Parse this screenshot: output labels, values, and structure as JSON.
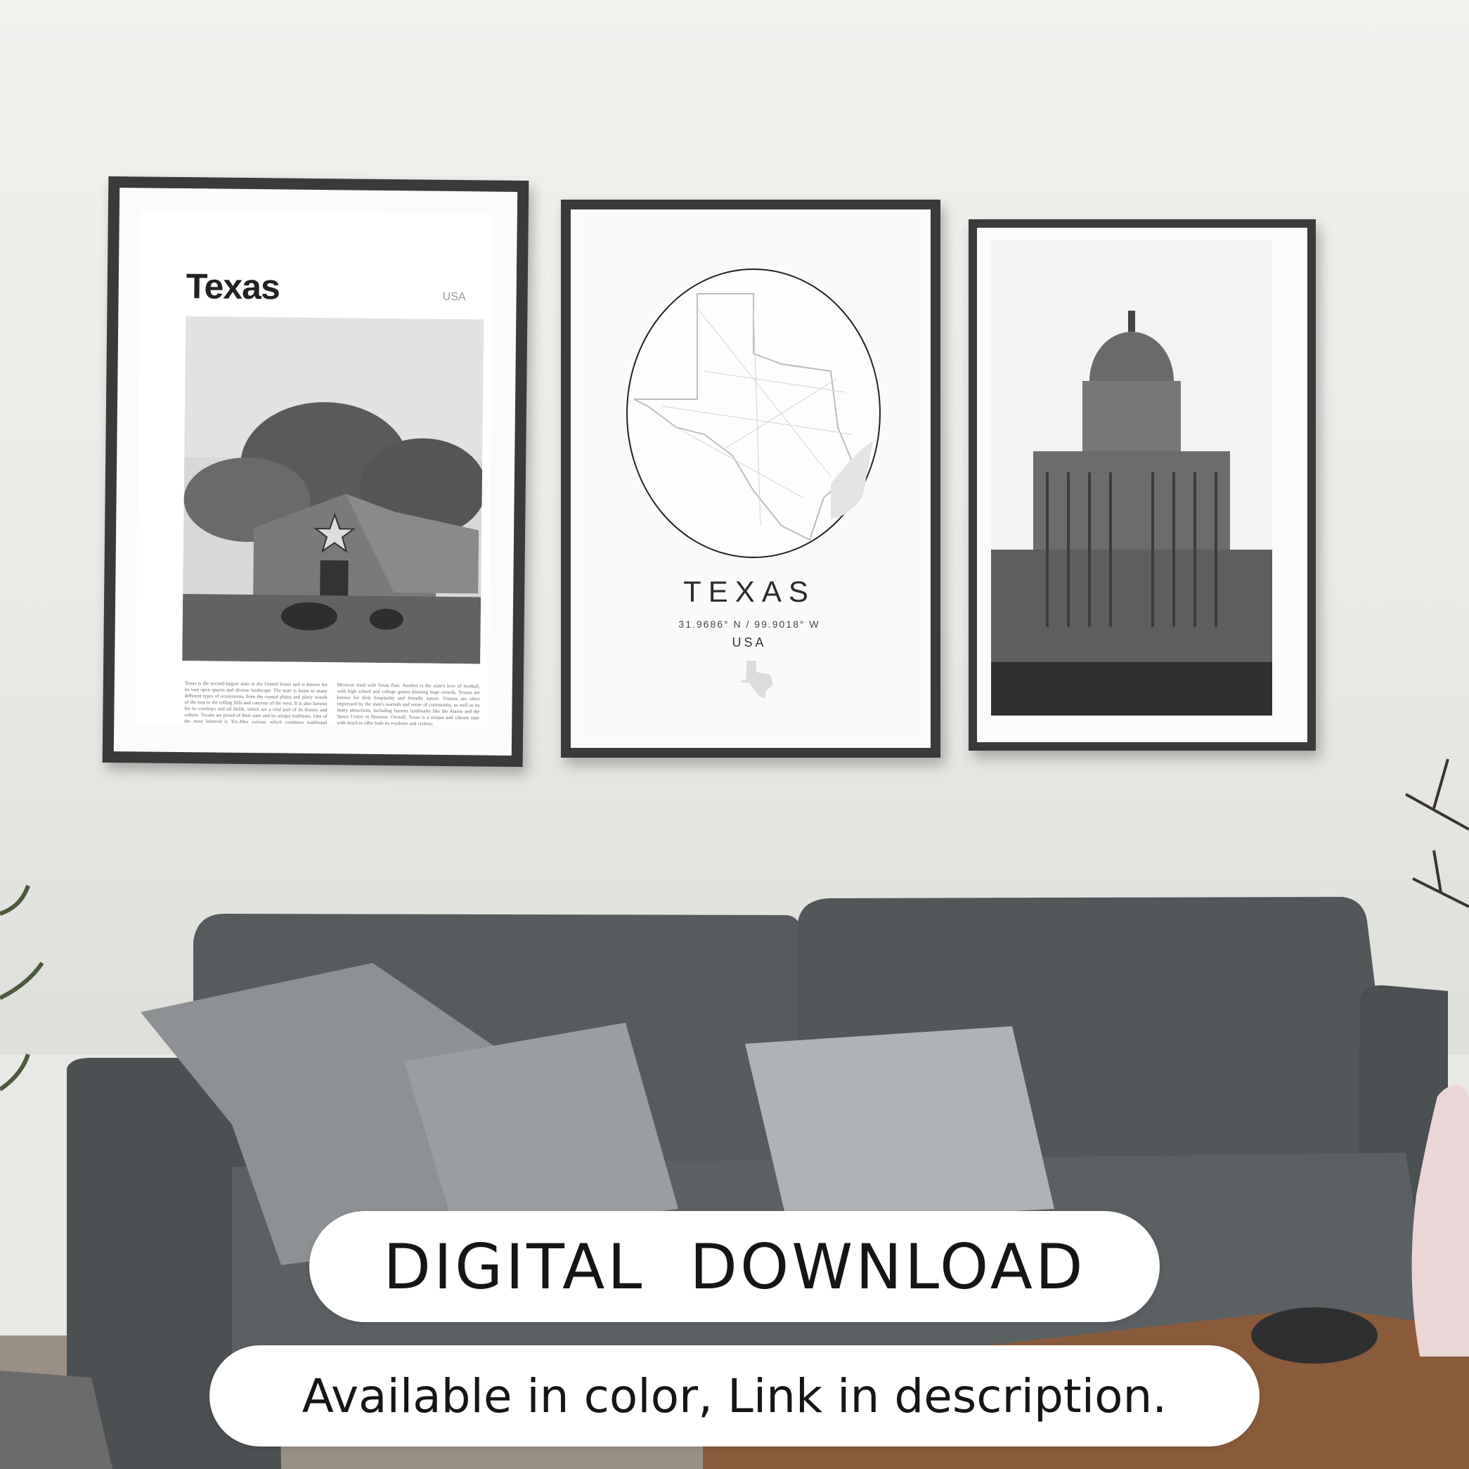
{
  "posters": {
    "left": {
      "title": "Texas",
      "country": "USA",
      "body": "Texas is the second-largest state in the United States and is known for its vast open spaces and diverse landscape. The state is home to many different types of ecosystems, from the coastal plains and piney woods of the east to the rolling hills and canyons of the west. It is also famous for its cowboys and oil fields, which are a vital part of its history and culture. Texans are proud of their state and its unique traditions. One of the most beloved is Tex-Mex cuisine, which combines traditional Mexican food with Texas flair. Another is the state's love of football, with high school and college games drawing huge crowds. Texans are known for their hospitality and friendly nature. Visitors are often impressed by the state's warmth and sense of community, as well as its many attractions, including famous landmarks like the Alamo and the Space Center in Houston. Overall, Texas is a unique and vibrant state with much to offer both its residents and visitors."
    },
    "center": {
      "title": "TEXAS",
      "coordinates": "31.9686° N / 99.9018° W",
      "country": "USA"
    }
  },
  "banners": {
    "primary": "DIGITAL  DOWNLOAD",
    "secondary": "Available in color, Link in description."
  },
  "colors": {
    "frame": "#3a3a3a",
    "sofa": "#50565a",
    "wall": "#eeeeeb",
    "banner_bg": "#ffffff",
    "banner_text": "#151515"
  }
}
